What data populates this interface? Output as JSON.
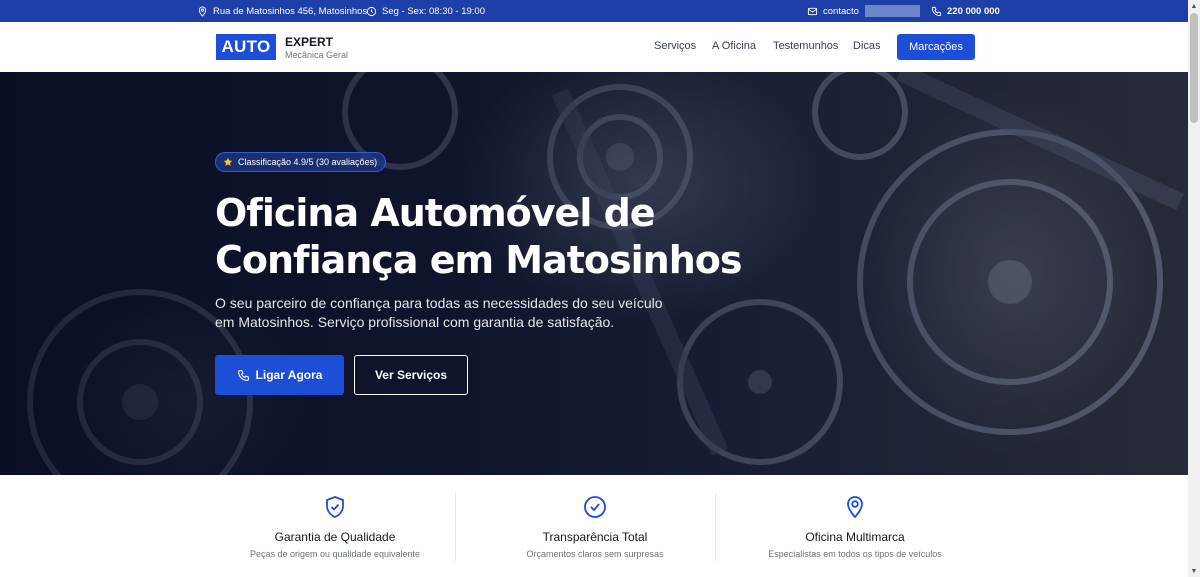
{
  "topbar": {
    "address": "Rua de Matosinhos 456, Matosinhos",
    "hours": "Seg - Sex: 08:30 - 19:00",
    "email_prefix": "contacto",
    "phone": "220 000 000"
  },
  "header": {
    "logo_mark": "AUTO",
    "logo_title": "EXPERT",
    "logo_subtitle": "Mecânica Geral",
    "nav": [
      "Serviços",
      "A Oficina",
      "Testemunhos",
      "Dicas"
    ],
    "cta_label": "Marcações"
  },
  "hero": {
    "rating_badge": "Classificação 4.9/5 (30 avaliações)",
    "title_line1": "Oficina Automóvel de",
    "title_line2": "Confiança em Matosinhos",
    "description": "O seu parceiro de confiança para todas as necessidades do seu veículo em Matosinhos. Serviço profissional com garantia de satisfação.",
    "primary_button": "Ligar Agora",
    "secondary_button": "Ver Serviços"
  },
  "features": [
    {
      "icon": "shield-check-icon",
      "title": "Garantia de Qualidade",
      "description": "Peças de origem ou qualidade equivalente"
    },
    {
      "icon": "check-circle-icon",
      "title": "Transparência Total",
      "description": "Orçamentos claros sem surpresas"
    },
    {
      "icon": "map-pin-icon",
      "title": "Oficina Multimarca",
      "description": "Especialistas em todos os tipos de veículos"
    }
  ],
  "colors": {
    "brand_blue": "#1d4ed8",
    "topbar_blue": "#1e3fa8",
    "hero_dark": "#131a34",
    "star_yellow": "#facc15"
  }
}
